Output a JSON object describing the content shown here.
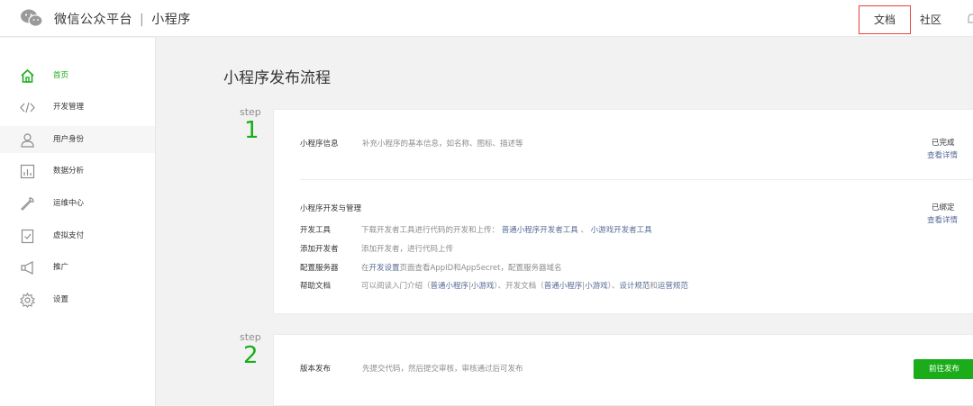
{
  "header": {
    "brand_main": "微信公众平台",
    "brand_sep": "|",
    "brand_sub": "小程序",
    "nav_doc": "文档",
    "nav_community": "社区"
  },
  "sidebar": {
    "items": [
      {
        "label": "首页",
        "icon": "home-icon",
        "active": true
      },
      {
        "label": "开发管理",
        "icon": "code-icon"
      },
      {
        "label": "用户身份",
        "icon": "user-icon"
      },
      {
        "label": "数据分析",
        "icon": "chart-icon"
      },
      {
        "label": "运维中心",
        "icon": "wrench-icon"
      },
      {
        "label": "虚拟支付",
        "icon": "payment-icon"
      },
      {
        "label": "推广",
        "icon": "megaphone-icon"
      },
      {
        "label": "设置",
        "icon": "gear-icon"
      }
    ]
  },
  "main": {
    "title": "小程序发布流程",
    "steps": [
      {
        "tag": "step",
        "number": "1",
        "info_label": "小程序信息",
        "info_desc": "补充小程序的基本信息，如名称、图标、描述等",
        "info_status": "已完成",
        "info_link": "查看详情",
        "dev_title": "小程序开发与管理",
        "dev_status": "已绑定",
        "dev_link": "查看详情",
        "rows": {
          "tools_label": "开发工具",
          "tools_desc": "下载开发者工具进行代码的开发和上传：",
          "tools_link1": "普通小程序开发者工具",
          "tools_sep": "、",
          "tools_link2": "小游戏开发者工具",
          "add_label": "添加开发者",
          "add_desc": "添加开发者，进行代码上传",
          "server_label": "配置服务器",
          "server_pre": "在",
          "server_link": "开发设置",
          "server_post": "页面查看AppID和AppSecret，配置服务器域名",
          "help_label": "帮助文档",
          "help_pre": "可以阅读入门介绍（",
          "help_link1": "普通小程序",
          "help_bar1": "|",
          "help_link2": "小游戏",
          "help_mid": "）、开发文档（",
          "help_link3": "普通小程序",
          "help_bar2": "|",
          "help_link4": "小游戏",
          "help_mid2": "）、",
          "help_link5": "设计规范",
          "help_and": "和",
          "help_link6": "运营规范"
        }
      },
      {
        "tag": "step",
        "number": "2",
        "label": "版本发布",
        "desc": "先提交代码，然后提交审核，审核通过后可发布",
        "button": "前往发布"
      }
    ]
  },
  "colors": {
    "accent": "#1aad19",
    "link": "#576b95",
    "highlight_border": "#e64340"
  }
}
